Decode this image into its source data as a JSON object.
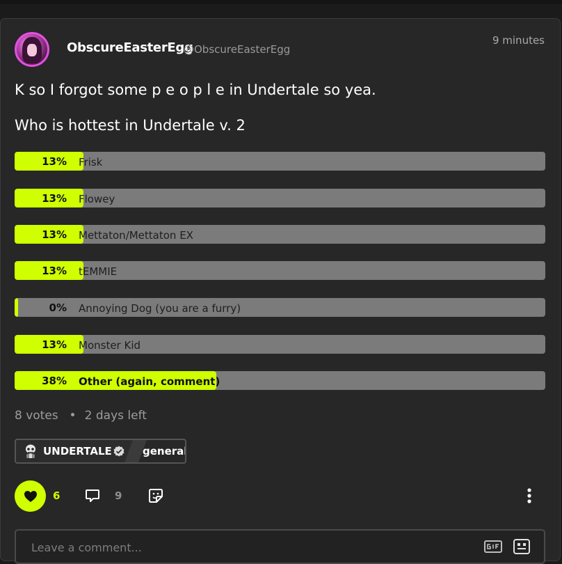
{
  "post": {
    "username": "ObscureEasterEgg",
    "handle": "@ObscureEasterEgg",
    "time": "9 minutes",
    "text": "K so I forgot some p e o p l e in Undertale so yea.",
    "poll_question": "Who is hottest in Undertale v. 2"
  },
  "poll": {
    "options": [
      {
        "label": "Frisk",
        "percent_text": "13%",
        "percent": 13
      },
      {
        "label": "Flowey",
        "percent_text": "13%",
        "percent": 13
      },
      {
        "label": "Mettaton/Mettaton EX",
        "percent_text": "13%",
        "percent": 13
      },
      {
        "label": "tEMMIE",
        "percent_text": "13%",
        "percent": 13
      },
      {
        "label": "Annoying Dog (you are a furry)",
        "percent_text": "0%",
        "percent": 0
      },
      {
        "label": "Monster Kid",
        "percent_text": "13%",
        "percent": 13
      },
      {
        "label": "Other (again, comment)",
        "percent_text": "38%",
        "percent": 38,
        "leading": true
      }
    ],
    "votes": "8 votes",
    "time_left": "2 days left"
  },
  "tags": {
    "community": "UNDERTALE",
    "category": "general"
  },
  "actions": {
    "likes": "6",
    "comments": "9"
  },
  "comment_box": {
    "placeholder": "Leave a comment..."
  },
  "colors": {
    "accent": "#cfff00",
    "background": "#272727",
    "poll_track": "#7b7b7b"
  },
  "icons": [
    "heart-icon",
    "comment-icon",
    "share-sticker-icon",
    "more-vertical-icon",
    "gif-icon",
    "sticker-icon",
    "verified-icon",
    "sans-skull-icon"
  ]
}
